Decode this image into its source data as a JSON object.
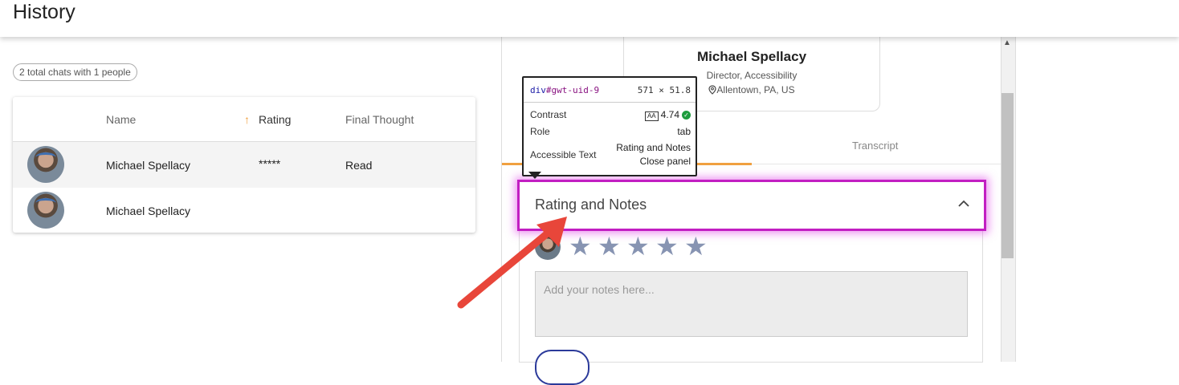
{
  "header": {
    "title": "History"
  },
  "summary": {
    "chip": "2 total chats with 1 people"
  },
  "table": {
    "columns": {
      "name": "Name",
      "rating": "Rating",
      "final_thought": "Final Thought"
    },
    "sort_icon": "arrow-up-icon",
    "rows": [
      {
        "name": "Michael Spellacy",
        "rating": "*****",
        "final_thought": "Read"
      },
      {
        "name": "Michael Spellacy",
        "rating": "",
        "final_thought": ""
      }
    ]
  },
  "profile": {
    "name": "Michael Spellacy",
    "role": "Director, Accessibility",
    "location": "Allentown, PA, US"
  },
  "tabs": {
    "transcript": "Transcript"
  },
  "accordion": {
    "title": "Rating and Notes",
    "stars": [
      "★",
      "★",
      "★",
      "★",
      "★"
    ],
    "notes_placeholder": "Add your notes here..."
  },
  "inspector": {
    "selector_tag": "div",
    "selector_id": "#gwt-uid-9",
    "dimensions": "571 × 51.8",
    "contrast_label": "Contrast",
    "contrast_badge": "AA",
    "contrast_value": "4.74",
    "role_label": "Role",
    "role_value": "tab",
    "accessible_text_label": "Accessible Text",
    "accessible_text_line1": "Rating and Notes",
    "accessible_text_line2": "Close panel"
  },
  "colors": {
    "highlight": "#c21ec2",
    "accent": "#f0a040",
    "annotation_arrow": "#e8463a",
    "star": "#8794b2"
  }
}
